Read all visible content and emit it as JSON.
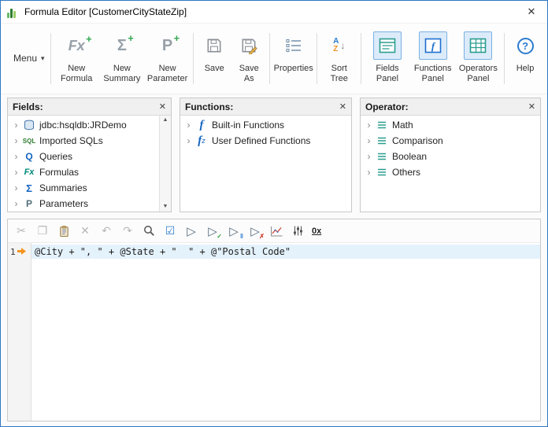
{
  "window": {
    "title": "Formula Editor [CustomerCityStateZip]"
  },
  "icons": {
    "close": "✕",
    "menu_caret": "▾",
    "new_formula": "Fx",
    "new_summary": "Σ",
    "new_parameter": "P",
    "plus_badge": "+",
    "sort_a": "A",
    "sort_z": "Z",
    "sort_arrow": "↓",
    "help": "?",
    "chevron": "›",
    "scroll_up": "▲",
    "scroll_down": "▼"
  },
  "toolbar": {
    "menu": "Menu",
    "new_formula": "New Formula",
    "new_summary": "New Summary",
    "new_parameter": "New Parameter",
    "save": "Save",
    "save_as": "Save As",
    "properties": "Properties",
    "sort_tree": "Sort Tree",
    "fields_panel": "Fields Panel",
    "functions_panel": "Functions Panel",
    "operators_panel": "Operators Panel",
    "help": "Help"
  },
  "panels": {
    "fields": {
      "title": "Fields:",
      "items": [
        {
          "icon": "database-icon",
          "label": "jdbc:hsqldb:JRDemo"
        },
        {
          "icon": "sql-icon",
          "icon_text": "SQL",
          "label": "Imported SQLs"
        },
        {
          "icon": "query-icon",
          "icon_text": "Q",
          "label": "Queries"
        },
        {
          "icon": "formula-icon",
          "icon_text": "Fx",
          "label": "Formulas"
        },
        {
          "icon": "summary-icon",
          "icon_text": "Σ",
          "label": "Summaries"
        },
        {
          "icon": "parameter-icon",
          "icon_text": "P",
          "label": "Parameters"
        }
      ]
    },
    "functions": {
      "title": "Functions:",
      "items": [
        {
          "icon": "builtin-function-icon",
          "icon_text": "f",
          "label": "Built-in Functions"
        },
        {
          "icon": "user-function-icon",
          "icon_text": "f",
          "icon_sub": "z",
          "label": "User Defined Functions"
        }
      ]
    },
    "operators": {
      "title": "Operator:",
      "items": [
        {
          "icon": "operator-list-icon",
          "label": "Math"
        },
        {
          "icon": "operator-list-icon",
          "label": "Comparison"
        },
        {
          "icon": "operator-list-icon",
          "label": "Boolean"
        },
        {
          "icon": "operator-list-icon",
          "label": "Others"
        }
      ]
    }
  },
  "editor": {
    "line_number": "1",
    "code": "@City + \", \" + @State + \"  \" + @\"Postal Code\"",
    "icons": {
      "cut": "✂",
      "copy": "❐",
      "delete": "✕",
      "undo": "↶",
      "redo": "↷",
      "check": "☑",
      "run": "▷",
      "mark_check": "✓",
      "mark_bar": "‖",
      "mark_x": "✗",
      "hex": "0x"
    }
  },
  "colors": {
    "window_border": "#2f77c4",
    "toggle_active_bg": "#dcebfa",
    "toggle_active_border": "#7ab0e2",
    "line_highlight": "#e4f2fc",
    "badge_green": "#34a853"
  }
}
